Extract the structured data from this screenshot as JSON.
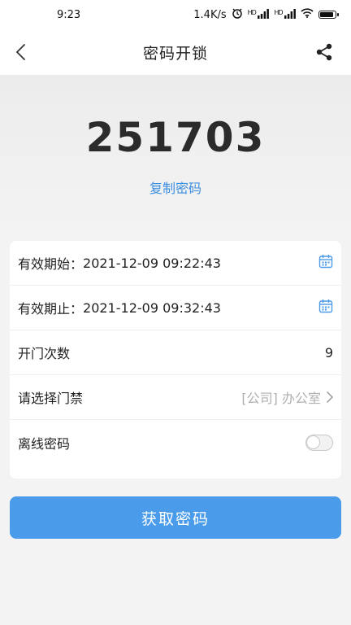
{
  "status_bar": {
    "time": "9:23",
    "net_speed": "1.4K/s",
    "signal1_label": "HD",
    "signal2_label": "HD"
  },
  "header": {
    "title": "密码开锁"
  },
  "code": {
    "value": "251703",
    "copy_label": "复制密码"
  },
  "form": {
    "start_label": "有效期始：",
    "start_value": "2021-12-09 09:22:43",
    "end_label": "有效期止：",
    "end_value": "2021-12-09 09:32:43",
    "count_label": "开门次数",
    "count_value": "9",
    "door_label": "请选择门禁",
    "door_value": "[公司] 办公室",
    "offline_label": "离线密码",
    "offline_enabled": false
  },
  "actions": {
    "submit_label": "获取密码"
  },
  "colors": {
    "accent": "#4a9be9",
    "link": "#3d8fe0"
  }
}
